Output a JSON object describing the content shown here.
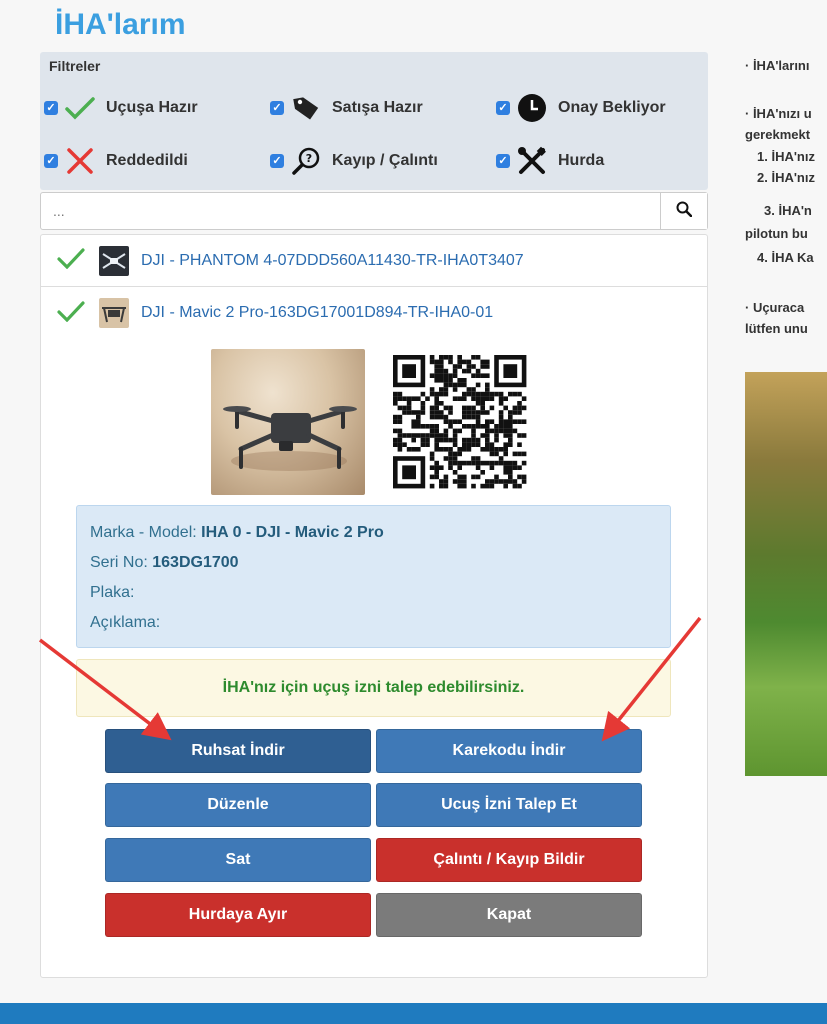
{
  "page": {
    "title": "İHA'larım"
  },
  "filters": {
    "title": "Filtreler",
    "items": [
      {
        "label": "Uçuşa Hazır",
        "icon": "check-icon",
        "checked": true
      },
      {
        "label": "Satışa Hazır",
        "icon": "tag-icon",
        "checked": true
      },
      {
        "label": "Onay Bekliyor",
        "icon": "clock-icon",
        "checked": true
      },
      {
        "label": "Reddedildi",
        "icon": "x-icon",
        "checked": true
      },
      {
        "label": "Kayıp / Çalıntı",
        "icon": "magnifier-question-icon",
        "checked": true
      },
      {
        "label": "Hurda",
        "icon": "tools-icon",
        "checked": true
      }
    ]
  },
  "search": {
    "placeholder": "..."
  },
  "list": {
    "items": [
      {
        "text": "DJI - PHANTOM 4-07DDD560A11430-TR-IHA0T3407",
        "status_icon": "check-icon"
      },
      {
        "text": "DJI - Mavic 2 Pro-163DG17001D894-TR-IHA0-01",
        "status_icon": "check-icon"
      }
    ]
  },
  "detail": {
    "brand_label": "Marka - Model:",
    "brand_value": "IHA 0 - DJI - Mavic 2 Pro",
    "serial_label": "Seri No:",
    "serial_value": "163DG1700",
    "plate_label": "Plaka:",
    "desc_label": "Açıklama:",
    "alert": "İHA'nız için uçuş izni talep edebilirsiniz."
  },
  "buttons": {
    "license": "Ruhsat İndir",
    "qr": "Karekodu İndir",
    "edit": "Düzenle",
    "flight_permit": "Ucuş İzni Talep Et",
    "sell": "Sat",
    "report_lost": "Çalıntı / Kayıp Bildir",
    "scrap": "Hurdaya Ayır",
    "close": "Kapat"
  },
  "right_panel": {
    "lines": [
      "· İHA'larını",
      "· İHA'nızı u",
      "gerekmekt",
      "1. İHA'nız",
      "2. İHA'nız",
      "3. İHA'n",
      "pilotun bu",
      "4. İHA Ka",
      "· Uçuraca",
      "lütfen unu"
    ]
  },
  "colors": {
    "accent": "#3b9fe0",
    "button_blue": "#3f79b7",
    "button_red": "#c9302c",
    "button_gray": "#7b7b7b",
    "footer": "#1f7bbf",
    "annotation_arrow": "#e53935"
  }
}
